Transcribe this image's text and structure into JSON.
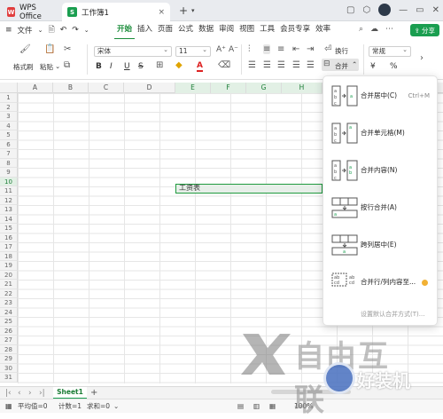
{
  "titlebar": {
    "tabs": [
      {
        "label": "WPS Office",
        "logo_color": "#e13e3e"
      },
      {
        "label": "工作簿1",
        "logo_color": "#1a9e50",
        "logo_letter": "S"
      }
    ],
    "plus": "+",
    "close": "×"
  },
  "menubar": {
    "file_label": "文件",
    "items": [
      "开始",
      "插入",
      "页面",
      "公式",
      "数据",
      "审阅",
      "视图",
      "工具",
      "会员专享",
      "效率"
    ],
    "active": "开始",
    "share_label": "分享"
  },
  "ribbon": {
    "format_painter": "格式刷",
    "paste": "粘贴",
    "font_name": "宋体",
    "font_size": "11",
    "bold": "B",
    "italic": "I",
    "underline": "U",
    "font_color_letter": "A",
    "wrap_label": "换行",
    "merge_label": "合并",
    "number_format": "常规",
    "currency": "¥",
    "percent": "%"
  },
  "sheet": {
    "columns": [
      "A",
      "B",
      "C",
      "D",
      "E",
      "F",
      "G",
      "H"
    ],
    "selected_columns": [
      "E",
      "F",
      "G",
      "H"
    ],
    "rows": [
      "1",
      "2",
      "3",
      "4",
      "5",
      "6",
      "7",
      "8",
      "9",
      "10",
      "11",
      "12",
      "13",
      "14",
      "15",
      "16",
      "17",
      "18",
      "19",
      "20",
      "21",
      "22",
      "23",
      "24",
      "25",
      "26",
      "27",
      "28",
      "29",
      "30",
      "31"
    ],
    "selected_row": "10",
    "merged_cell_text": "工资表"
  },
  "merge_menu": {
    "items": [
      {
        "label": "合并居中(C)",
        "shortcut": "Ctrl+M"
      },
      {
        "label": "合并单元格(M)",
        "shortcut": ""
      },
      {
        "label": "合并内容(N)",
        "shortcut": ""
      },
      {
        "label": "按行合并(A)",
        "shortcut": ""
      },
      {
        "label": "跨列居中(E)",
        "shortcut": ""
      },
      {
        "label": "合并行/列内容至...",
        "shortcut": ""
      }
    ],
    "footer": "设置默认合并方式(T)..."
  },
  "sheetbar": {
    "tab": "Sheet1",
    "plus": "+"
  },
  "statusbar": {
    "average": "平均值=0",
    "count": "计数=1",
    "sum": "求和=0",
    "zoom": "100%"
  },
  "watermark": {
    "brand1": "自由互联",
    "brand2": "好装机"
  },
  "colors": {
    "accent": "#1a9e50",
    "selection_border": "#1f9a3e",
    "selection_fill": "#e7efe9"
  }
}
